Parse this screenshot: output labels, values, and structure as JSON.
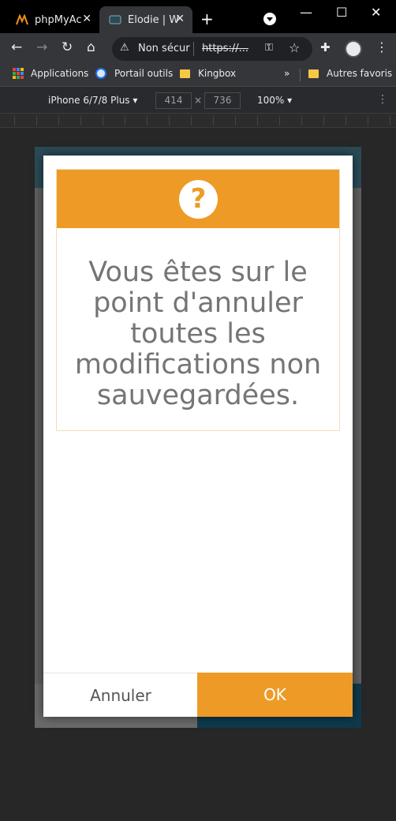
{
  "browser": {
    "tabs": [
      {
        "label": "phpMyAc",
        "icon": "phpmyadmin-icon"
      },
      {
        "label": "Elodie | W",
        "icon": "site-icon"
      }
    ],
    "address": {
      "security": "Non sécur",
      "url": "https://..."
    },
    "bookmarks": [
      {
        "label": "Applications",
        "icon": "apps-grid-icon"
      },
      {
        "label": "Portail outils",
        "icon": "portal-icon"
      },
      {
        "label": "Kingbox",
        "icon": "folder-icon"
      },
      {
        "label": "Autres favoris",
        "icon": "folder-icon"
      }
    ],
    "bookmarks_overflow": "»"
  },
  "devtools": {
    "device": "iPhone 6/7/8 Plus",
    "width": "414",
    "height": "736",
    "zoom": "100%"
  },
  "dialog": {
    "icon": "question-circle-icon",
    "icon_glyph": "?",
    "message": "Vous êtes sur le point d'annuler toutes les modifications non sauvegardées.",
    "cancel_label": "Annuler",
    "ok_label": "OK"
  },
  "colors": {
    "accent": "#ed9b26",
    "page_header": "#2a4b56",
    "page_footer": "#0e3a4c"
  }
}
